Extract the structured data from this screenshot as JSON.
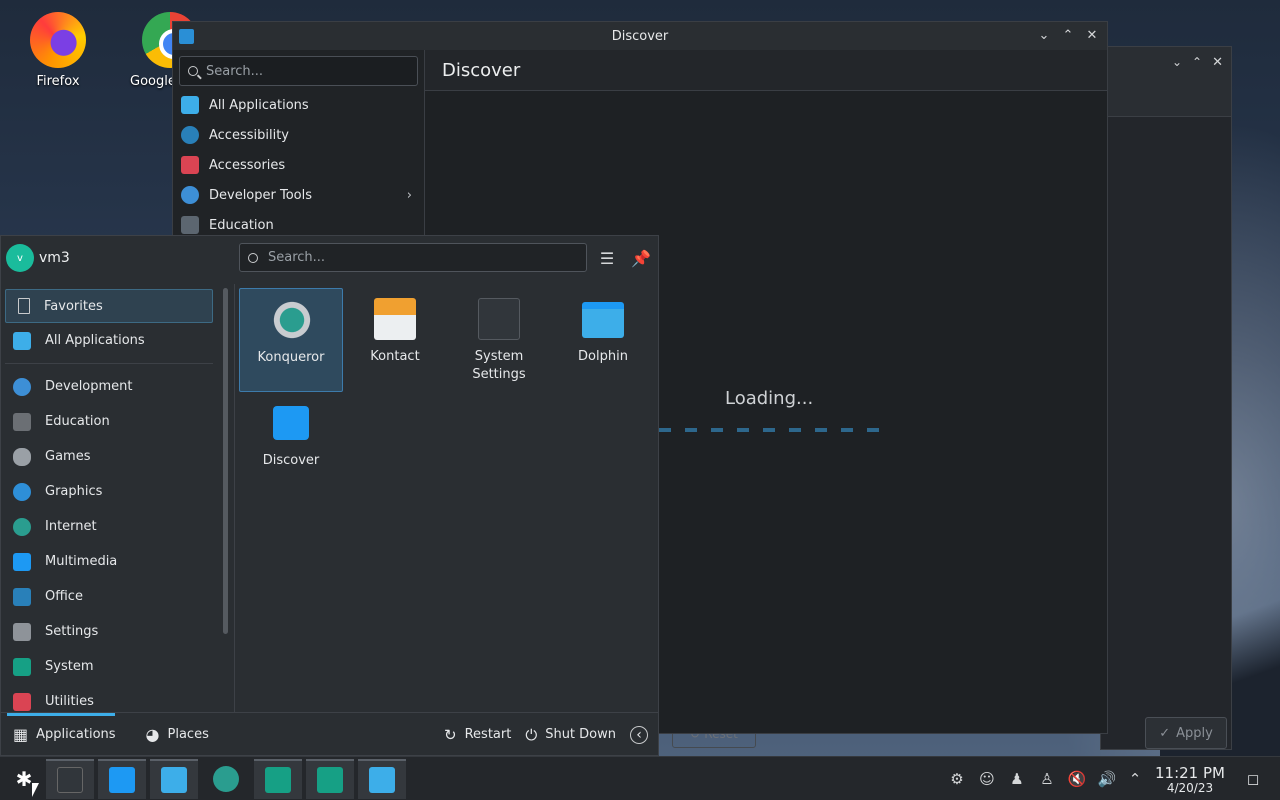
{
  "desktop": {
    "icons": [
      {
        "label": "Firefox"
      },
      {
        "label": "Google"
      }
    ]
  },
  "discover_window": {
    "title": "Discover",
    "search_placeholder": "Search...",
    "categories": [
      {
        "label": "All Applications",
        "color": "#3daee9"
      },
      {
        "label": "Accessibility",
        "color": "#2980b9"
      },
      {
        "label": "Accessories",
        "color": "#da4453"
      },
      {
        "label": "Developer Tools",
        "color": "#3d8fd6"
      },
      {
        "label": "Education",
        "color": "#5c6670"
      }
    ],
    "page_title": "Discover",
    "loading_text": "Loading..."
  },
  "back_window": {
    "apply_label": "Apply",
    "reset_label": "Reset"
  },
  "launcher": {
    "user_initial": "v",
    "username": "vm3",
    "search_placeholder": "Search...",
    "categories": [
      {
        "label": "Favorites",
        "color": "#9aa0a6"
      },
      {
        "label": "All Applications",
        "color": "#3daee9"
      },
      {
        "label": "Development",
        "color": "#3d8fd6"
      },
      {
        "label": "Education",
        "color": "#6b6f74"
      },
      {
        "label": "Games",
        "color": "#9aa0a6"
      },
      {
        "label": "Graphics",
        "color": "#2e8fd8"
      },
      {
        "label": "Internet",
        "color": "#2a9d8f"
      },
      {
        "label": "Multimedia",
        "color": "#1d99f3"
      },
      {
        "label": "Office",
        "color": "#2980b9"
      },
      {
        "label": "Settings",
        "color": "#8e9399"
      },
      {
        "label": "System",
        "color": "#16a085"
      },
      {
        "label": "Utilities",
        "color": "#da4453"
      }
    ],
    "favorites": [
      {
        "label": "Konqueror",
        "color": "#3daee9"
      },
      {
        "label": "Kontact",
        "color": "#f0a030"
      },
      {
        "label": "System Settings",
        "color": "#31363b"
      },
      {
        "label": "Dolphin",
        "color": "#3daee9"
      },
      {
        "label": "Discover",
        "color": "#1d99f3"
      }
    ],
    "footer": {
      "applications": "Applications",
      "places": "Places",
      "restart": "Restart",
      "shutdown": "Shut Down"
    }
  },
  "taskbar": {
    "time": "11:21 PM",
    "date": "4/20/23"
  }
}
